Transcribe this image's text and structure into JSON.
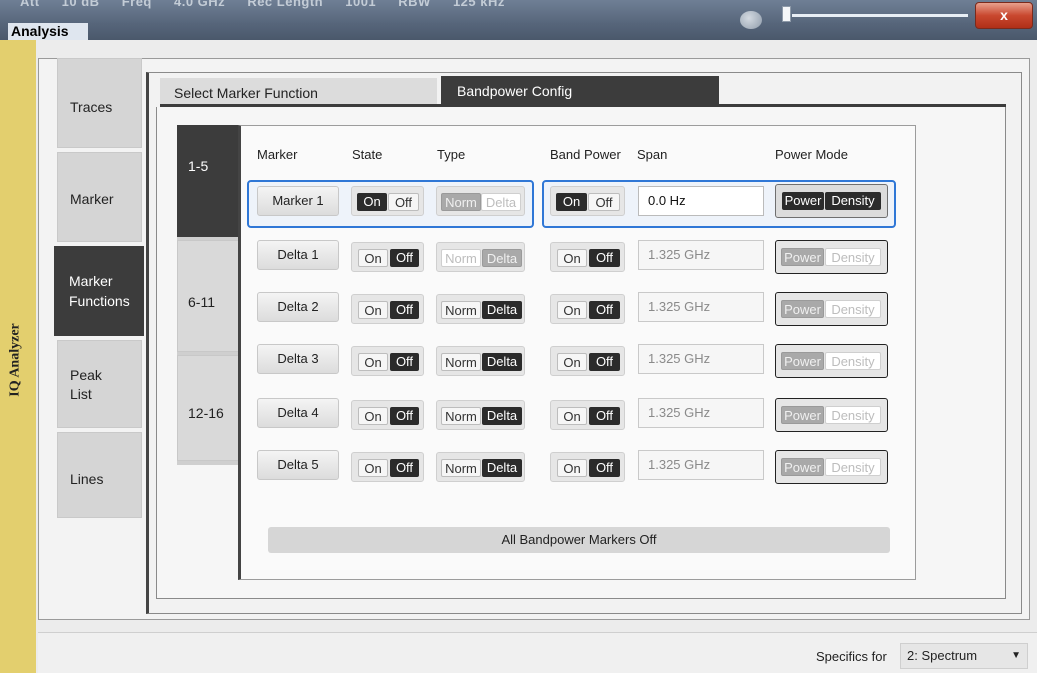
{
  "window": {
    "title": "Analysis",
    "close_glyph": "x",
    "status_strip": [
      "Att",
      "10 dB",
      "Freq",
      "4.0 GHz",
      "Rec Length",
      "1001",
      "RBW",
      "125 kHz"
    ]
  },
  "app_strip": {
    "label": "IQ Analyzer"
  },
  "side_tabs": [
    {
      "label": "Traces"
    },
    {
      "label": "Marker"
    },
    {
      "label": "Marker\nFunctions",
      "line1": "Marker",
      "line2": "Functions"
    },
    {
      "label": "Peak\nList",
      "line1": "Peak",
      "line2": "List"
    },
    {
      "label": "Lines"
    }
  ],
  "top_tabs": {
    "select_marker_function": "Select Marker Function",
    "bandpower_config": "Bandpower Config"
  },
  "range_tabs": [
    "1-5",
    "6-11",
    "12-16"
  ],
  "table": {
    "headers": {
      "marker": "Marker",
      "state": "State",
      "type": "Type",
      "band_power": "Band Power",
      "span": "Span",
      "power_mode": "Power Mode"
    },
    "rows": [
      {
        "marker": "Marker 1",
        "state": "On",
        "type": "Norm",
        "band_power": "On",
        "span": "0.0 Hz",
        "power_mode": "Power"
      },
      {
        "marker": "Delta 1",
        "state": "Off",
        "type": "Delta",
        "band_power": "Off",
        "span": "1.325 GHz",
        "power_mode": "Power"
      },
      {
        "marker": "Delta 2",
        "state": "Off",
        "type": "Delta",
        "band_power": "Off",
        "span": "1.325 GHz",
        "power_mode": "Power"
      },
      {
        "marker": "Delta 3",
        "state": "Off",
        "type": "Delta",
        "band_power": "Off",
        "span": "1.325 GHz",
        "power_mode": "Power"
      },
      {
        "marker": "Delta 4",
        "state": "Off",
        "type": "Delta",
        "band_power": "Off",
        "span": "1.325 GHz",
        "power_mode": "Power"
      },
      {
        "marker": "Delta 5",
        "state": "Off",
        "type": "Delta",
        "band_power": "Off",
        "span": "1.325 GHz",
        "power_mode": "Power"
      }
    ],
    "labels": {
      "on": "On",
      "off": "Off",
      "norm": "Norm",
      "delta": "Delta",
      "power": "Power",
      "density": "Density"
    }
  },
  "all_off_button": "All Bandpower Markers Off",
  "specifics": {
    "label": "Specifics for",
    "value": "2: Spectrum"
  },
  "colors": {
    "selection_border": "#2f77d6",
    "active_tab": "#3c3c3c",
    "app_strip": "#e3cf6e"
  }
}
